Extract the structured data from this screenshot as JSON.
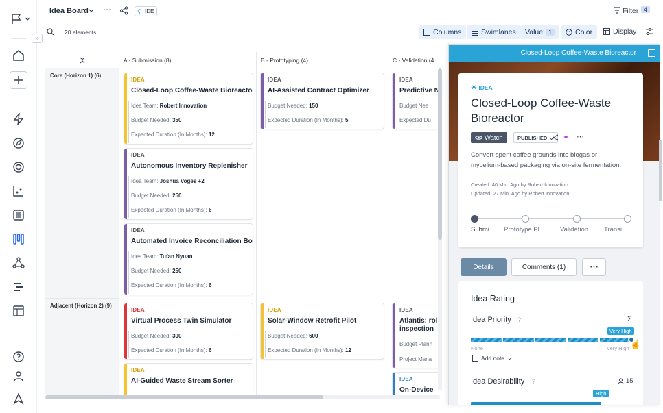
{
  "header": {
    "board_title": "Idea Board",
    "tag_label": "IDE",
    "filter_label": "Filter",
    "filter_count": "4"
  },
  "toolbar": {
    "elements_count": "20 elements",
    "columns_label": "Columns",
    "swimlanes_label": "Swimlanes",
    "value_label": "Value",
    "value_count": "1",
    "color_label": "Color",
    "display_label": "Display"
  },
  "board": {
    "columns": [
      "A - Submission (8)",
      "B - Prototyping (4)",
      "C - Validation (4"
    ],
    "lanes": [
      "Core (Horizon 1) (6)",
      "Adjacent (Horizon 2) (9)"
    ],
    "cards": [
      {
        "type": "IDEA",
        "title": "Closed-Loop Coffee-Waste Bioreactor",
        "f1k": "Idea Team:",
        "f1v": "Robert Innovation",
        "f2k": "Budget Needed:",
        "f2v": "350",
        "f3k": "Expected Duration (In Months):",
        "f3v": "12"
      },
      {
        "type": "IDEA",
        "title": "Autonomous Inventory Replenisher",
        "f1k": "Idea Team:",
        "f1v": "Joshua Voges +2",
        "f2k": "Budget Needed:",
        "f2v": "250",
        "f3k": "Expected Duration (In Months):",
        "f3v": "6"
      },
      {
        "type": "IDEA",
        "title": "Automated Invoice Reconciliation Bot",
        "f1k": "Idea Team:",
        "f1v": "Tufan Nyuan",
        "f2k": "Budget Needed:",
        "f2v": "250",
        "f3k": "Expected Duration (In Months):",
        "f3v": "6"
      },
      {
        "type": "IDEA",
        "title": "AI-Assisted Contract Optimizer",
        "f2k": "Budget Needed:",
        "f2v": "150",
        "f3k": "Expected Duration (In Months):",
        "f3v": "5"
      },
      {
        "type": "IDEA",
        "title": "Predictive N",
        "f2k": "Budget Nee",
        "f3k": "Expected Du"
      },
      {
        "type": "IDEA",
        "title": "Virtual Process Twin Simulator",
        "f2k": "Budget Needed:",
        "f2v": "300",
        "f3k": "Expected Duration (In Months):",
        "f3v": "6"
      },
      {
        "type": "IDEA",
        "title": "AI-Guided Waste Stream Sorter"
      },
      {
        "type": "IDEA",
        "title": "Solar-Window Retrofit Pilot",
        "f2k": "Budget Needed:",
        "f2v": "600",
        "f3k": "Expected Duration (In Months):",
        "f3v": "12"
      },
      {
        "type": "IDEA",
        "title": "Atlantis: rol",
        "title2": "inspection",
        "f2k": "Budget Plann",
        "f3k": "Project Mana"
      },
      {
        "type": "IDEA",
        "title": "On-Device"
      }
    ]
  },
  "panel": {
    "header_title": "Closed-Loop Coffee-Waste Bioreactor",
    "type": "IDEA",
    "title_line1": "Closed-Loop Coffee-Waste",
    "title_line2": "Bioreactor",
    "watch_label": "Watch",
    "status": "PUBLISHED",
    "description_line1": "Convert spent coffee grounds into biogas or",
    "description_line2": "mycelium-based packaging via on-site fermentation.",
    "created": "Created: 40 Min. Ago by Robert Innovation",
    "updated": "Updated: 27 Min. Ago by Robert Innovation",
    "stages": [
      "Submi...",
      "Prototype Pl...",
      "Validation",
      "Transi ..."
    ],
    "tabs": {
      "details": "Details",
      "comments": "Comments (1)"
    },
    "rating": {
      "title": "Idea Rating",
      "priority_label": "Idea Priority",
      "priority_value": "Very High",
      "priority_min": "None",
      "priority_max": "Very High",
      "add_note": "Add note",
      "desirability_label": "Idea Desirability",
      "desirability_count": "15",
      "desirability_value": "High"
    }
  },
  "colors": {
    "accent": "#2aa3d7",
    "yellow": "#f4c430",
    "purple": "#7b5ea7",
    "red": "#d9363e",
    "blue": "#2b7fc2"
  }
}
